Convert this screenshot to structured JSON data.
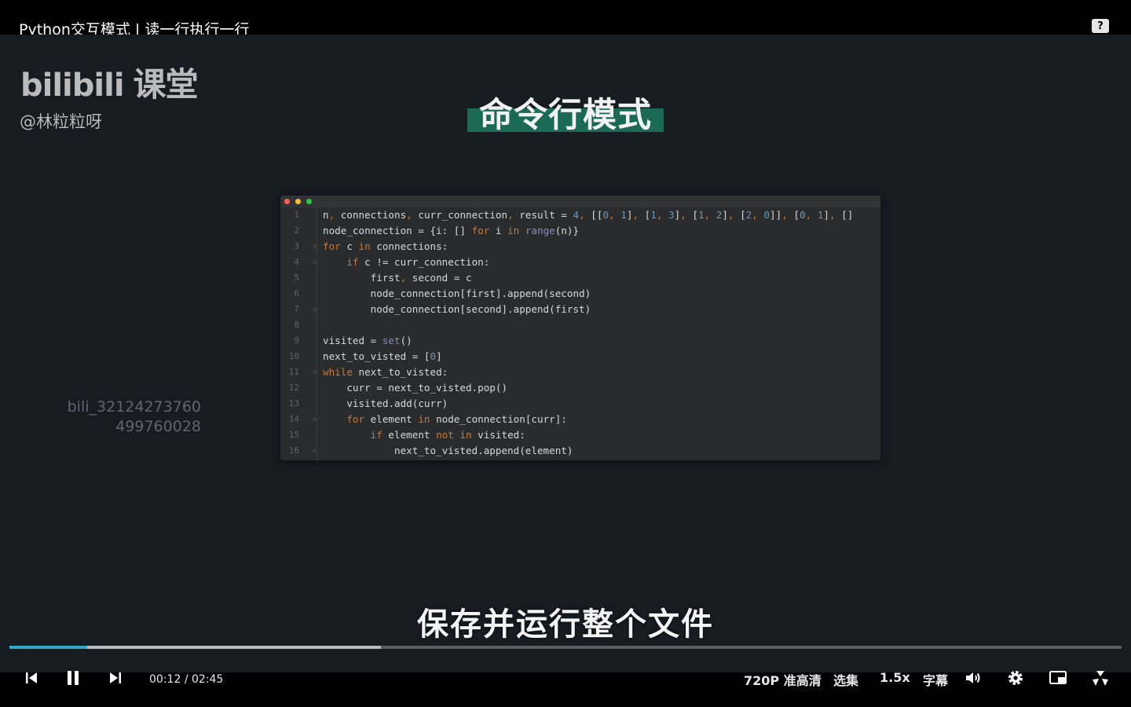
{
  "window": {
    "title": "Python交互模式 | 读一行执行一行"
  },
  "stage": {
    "logo": "bilibili",
    "logo_cn": "课堂",
    "author": "@林粒粒呀",
    "slide_title": "命令行模式",
    "watermark_line1": "bili_32124273760",
    "watermark_line2": "499760028",
    "subtitle": "保存并运行整个文件"
  },
  "code": {
    "line_numbers": [
      "1",
      "2",
      "3",
      "4",
      "5",
      "6",
      "7",
      "8",
      "9",
      "10",
      "11",
      "12",
      "13",
      "14",
      "15",
      "16"
    ]
  },
  "player": {
    "current_time": "00:12",
    "separator": "/",
    "total_time": "02:45",
    "played_fraction": 0.07,
    "buffered_fraction": 0.334,
    "quality": "720P 准高清",
    "episodes": "选集",
    "speed": "1.5x",
    "subtitles": "字幕"
  },
  "colors": {
    "accent": "#35a7c6",
    "slide_bg": "#171b22",
    "title_highlight": "#1b6a57"
  },
  "icons": [
    "help-icon",
    "prev-icon",
    "pause-icon",
    "next-icon",
    "volume-icon",
    "settings-icon",
    "pip-icon",
    "fullscreen-icon"
  ]
}
